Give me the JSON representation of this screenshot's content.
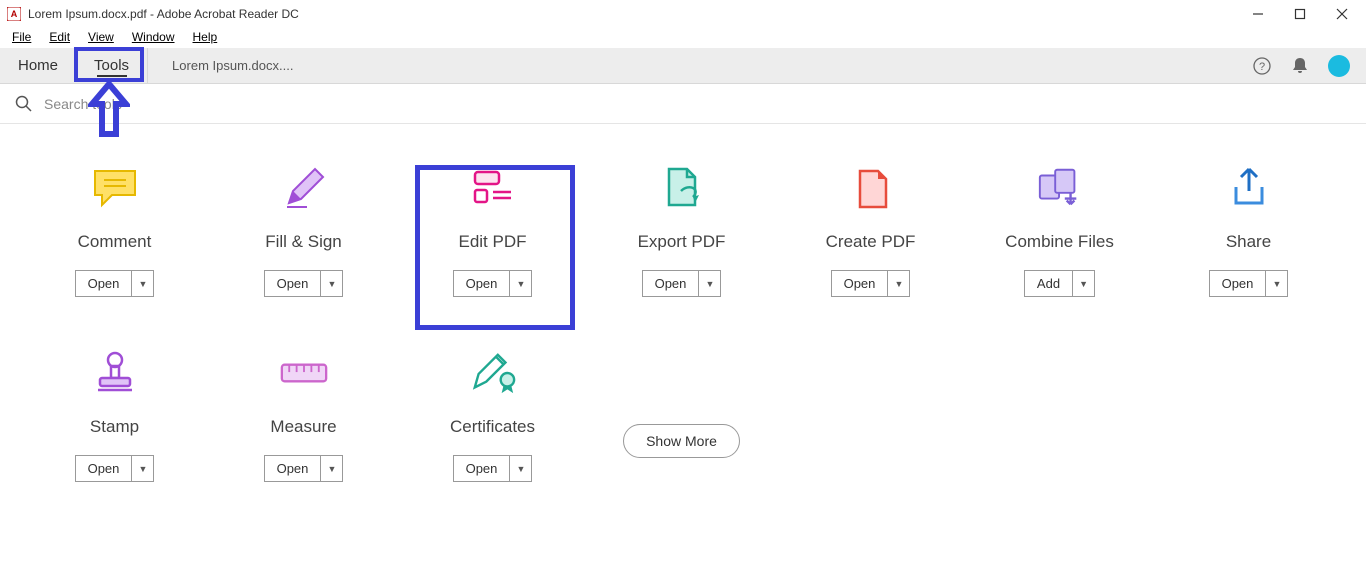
{
  "titlebar": {
    "title": "Lorem Ipsum.docx.pdf - Adobe Acrobat Reader DC"
  },
  "menubar": {
    "file": "File",
    "edit": "Edit",
    "view": "View",
    "window": "Window",
    "help": "Help"
  },
  "tabbar": {
    "home": "Home",
    "tools": "Tools",
    "doc": "Lorem Ipsum.docx...."
  },
  "search": {
    "placeholder": "Search tools"
  },
  "tools": {
    "comment": {
      "label": "Comment",
      "btn": "Open"
    },
    "fillsign": {
      "label": "Fill & Sign",
      "btn": "Open"
    },
    "editpdf": {
      "label": "Edit PDF",
      "btn": "Open"
    },
    "exportpdf": {
      "label": "Export PDF",
      "btn": "Open"
    },
    "createpdf": {
      "label": "Create PDF",
      "btn": "Open"
    },
    "combine": {
      "label": "Combine Files",
      "btn": "Add"
    },
    "share": {
      "label": "Share",
      "btn": "Open"
    },
    "stamp": {
      "label": "Stamp",
      "btn": "Open"
    },
    "measure": {
      "label": "Measure",
      "btn": "Open"
    },
    "certificates": {
      "label": "Certificates",
      "btn": "Open"
    }
  },
  "showmore": "Show More",
  "colors": {
    "highlight": "#3b3fd6"
  }
}
